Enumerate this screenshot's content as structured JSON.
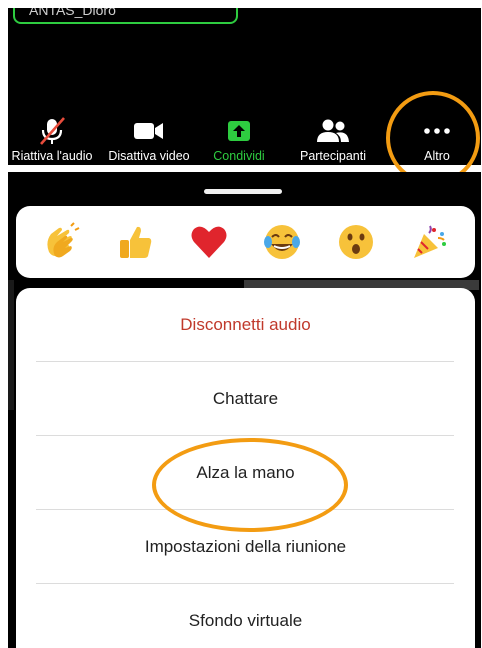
{
  "meeting": {
    "participant_name": "ANTAS_Dioro"
  },
  "toolbar": {
    "items": [
      {
        "label": "Riattiva l'audio",
        "icon": "microphone-muted-icon"
      },
      {
        "label": "Disattiva video",
        "icon": "video-camera-icon"
      },
      {
        "label": "Condividi",
        "icon": "share-screen-icon"
      },
      {
        "label": "Partecipanti",
        "icon": "participants-icon"
      },
      {
        "label": "Altro",
        "icon": "more-dots-icon"
      }
    ],
    "share_color": "#2ecc40"
  },
  "reactions": {
    "items": [
      {
        "icon": "clapping-hands-icon"
      },
      {
        "icon": "thumbs-up-icon"
      },
      {
        "icon": "red-heart-icon"
      },
      {
        "icon": "tears-of-joy-icon"
      },
      {
        "icon": "surprised-face-icon"
      },
      {
        "icon": "party-popper-icon"
      }
    ]
  },
  "menu": {
    "items": [
      {
        "label": "Disconnetti audio",
        "color": "#c0392b"
      },
      {
        "label": "Chattare"
      },
      {
        "label": "Alza la mano"
      },
      {
        "label": "Impostazioni della riunione"
      },
      {
        "label": "Sfondo virtuale"
      }
    ]
  },
  "highlight_color": "#f39c12"
}
